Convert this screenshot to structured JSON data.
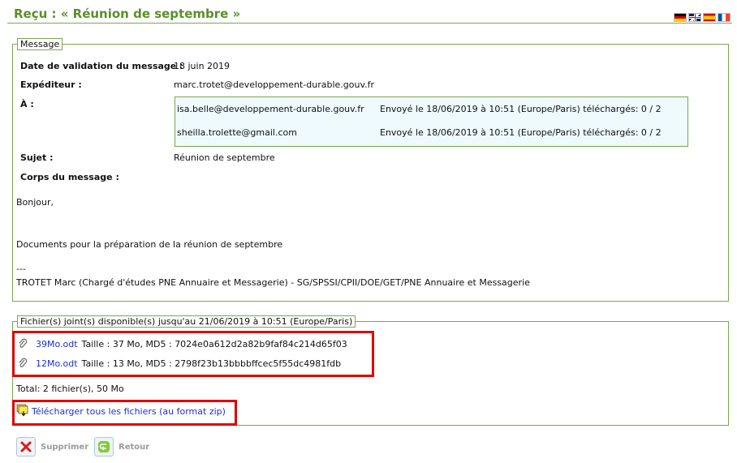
{
  "page": {
    "title": "Reçu : « Réunion de septembre »"
  },
  "languages": [
    "Deutsch",
    "English",
    "Español",
    "Français"
  ],
  "message": {
    "legend": "Message",
    "date_label": "Date de validation du message :",
    "date_value": "18 juin 2019",
    "sender_label": "Expéditeur :",
    "sender_value": "marc.trotet@developpement-durable.gouv.fr",
    "to_label": "À :",
    "recipients": [
      {
        "email": "isa.belle@developpement-durable.gouv.fr",
        "status": "Envoyé le 18/06/2019 à 10:51 (Europe/Paris) téléchargés: 0 / 2"
      },
      {
        "email": "sheilla.trolette@gmail.com",
        "status": "Envoyé le 18/06/2019 à 10:51 (Europe/Paris) téléchargés: 0 / 2"
      }
    ],
    "subject_label": "Sujet :",
    "subject_value": "Réunion de septembre",
    "body_label": "Corps du message :",
    "body_lines": [
      "Bonjour,",
      "Documents pour la préparation de la réunion de septembre",
      "---",
      "TROTET Marc (Chargé d'études PNE Annuaire et Messagerie) - SG/SPSSI/CPII/DOE/GET/PNE Annuaire et Messagerie"
    ]
  },
  "files": {
    "legend": "Fichier(s) joint(s) disponible(s) jusqu'au 21/06/2019 à 10:51 (Europe/Paris)",
    "items": [
      {
        "name": "39Mo.odt",
        "info": "Taille : 37 Mo, MD5 : 7024e0a612d2a82b9faf84c214d65f03"
      },
      {
        "name": "12Mo.odt",
        "info": "Taille : 13 Mo, MD5 : 2798f23b13bbbbffcec5f55dc4981fdb"
      }
    ],
    "total": "Total: 2 fichier(s), 50 Mo",
    "download_all": "Télécharger tous les fichiers (au format zip)"
  },
  "actions": {
    "delete": "Supprimer",
    "back": "Retour"
  }
}
